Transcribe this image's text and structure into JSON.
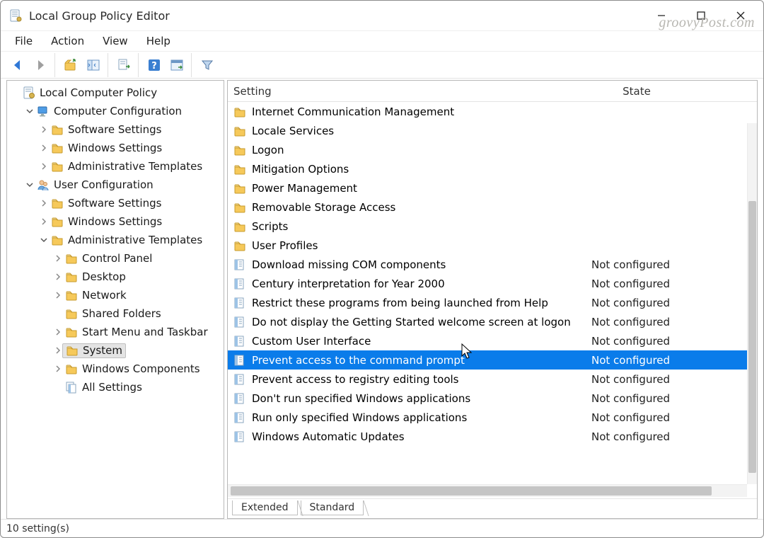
{
  "window": {
    "title": "Local Group Policy Editor",
    "watermark": "groovyPost.com"
  },
  "menu": {
    "file": "File",
    "action": "Action",
    "view": "View",
    "help": "Help"
  },
  "tree": {
    "root": "Local Computer Policy",
    "computer_configuration": "Computer Configuration",
    "software_settings_c": "Software Settings",
    "windows_settings_c": "Windows Settings",
    "administrative_templates_c": "Administrative Templates",
    "user_configuration": "User Configuration",
    "software_settings_u": "Software Settings",
    "windows_settings_u": "Windows Settings",
    "administrative_templates_u": "Administrative Templates",
    "control_panel": "Control Panel",
    "desktop": "Desktop",
    "network": "Network",
    "shared_folders": "Shared Folders",
    "start_menu_taskbar": "Start Menu and Taskbar",
    "system": "System",
    "windows_components": "Windows Components",
    "all_settings": "All Settings"
  },
  "list": {
    "header_setting": "Setting",
    "header_state": "State",
    "folders": [
      "Internet Communication Management",
      "Locale Services",
      "Logon",
      "Mitigation Options",
      "Power Management",
      "Removable Storage Access",
      "Scripts",
      "User Profiles"
    ],
    "settings": [
      {
        "label": "Download missing COM components",
        "state": "Not configured"
      },
      {
        "label": "Century interpretation for Year 2000",
        "state": "Not configured"
      },
      {
        "label": "Restrict these programs from being launched from Help",
        "state": "Not configured"
      },
      {
        "label": "Do not display the Getting Started welcome screen at logon",
        "state": "Not configured"
      },
      {
        "label": "Custom User Interface",
        "state": "Not configured"
      },
      {
        "label": "Prevent access to the command prompt",
        "state": "Not configured",
        "selected": true
      },
      {
        "label": "Prevent access to registry editing tools",
        "state": "Not configured"
      },
      {
        "label": "Don't run specified Windows applications",
        "state": "Not configured"
      },
      {
        "label": "Run only specified Windows applications",
        "state": "Not configured"
      },
      {
        "label": "Windows Automatic Updates",
        "state": "Not configured"
      }
    ],
    "tabs": {
      "extended": "Extended",
      "standard": "Standard"
    }
  },
  "statusbar": {
    "text": "10 setting(s)"
  }
}
